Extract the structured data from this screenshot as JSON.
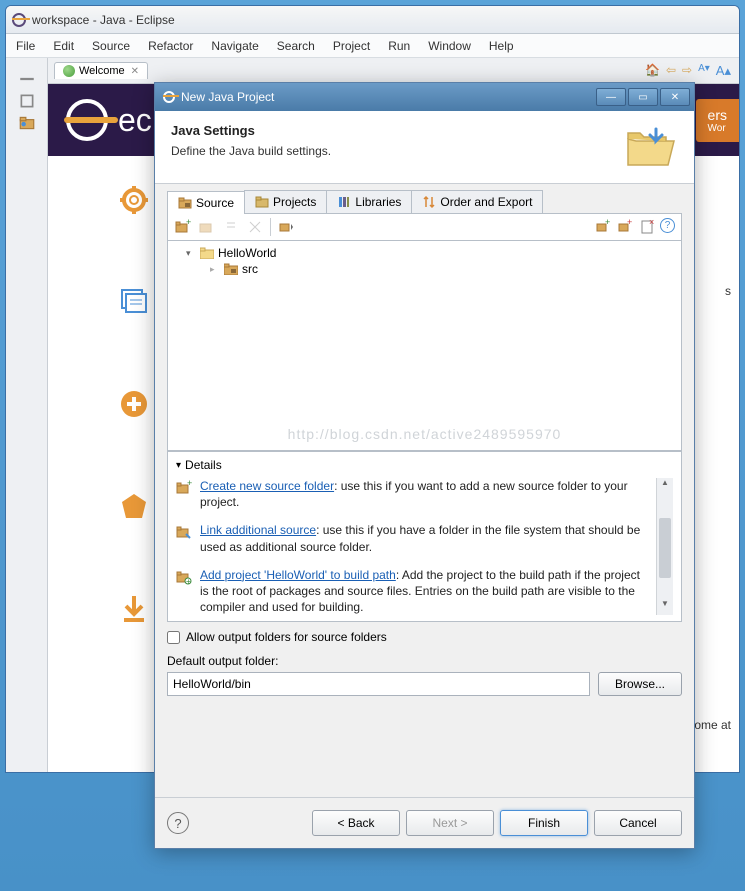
{
  "eclipse": {
    "title": "workspace - Java - Eclipse",
    "menu": [
      "File",
      "Edit",
      "Source",
      "Refactor",
      "Navigate",
      "Search",
      "Project",
      "Run",
      "Window",
      "Help"
    ],
    "welcome_tab": "Welcome",
    "tab_close": "✕",
    "banner_text": "ec",
    "banner_badge_top": "ers",
    "banner_badge_bottom": "Wor",
    "nav_icons": [
      "home-icon",
      "back-icon",
      "forward-icon",
      "text-small-icon",
      "text-large-icon"
    ],
    "side_hint": "s",
    "side_hint2": "ome at"
  },
  "dialog": {
    "title": "New Java Project",
    "controls": {
      "min": "—",
      "max": "▭",
      "close": "✕"
    },
    "header_title": "Java Settings",
    "header_sub": "Define the Java build settings.",
    "tabs": {
      "source": "Source",
      "projects": "Projects",
      "libraries": "Libraries",
      "order": "Order and Export"
    },
    "toolbar": {
      "help_icon": "?"
    },
    "tree": {
      "project": "HelloWorld",
      "src": "src"
    },
    "watermark": "http://blog.csdn.net/active2489595970",
    "details": {
      "heading": "Details",
      "caret": "▾",
      "items": [
        {
          "link": "Create new source folder",
          "text": ": use this if you want to add a new source folder to your project."
        },
        {
          "link": "Link additional source",
          "text": ": use this if you have a folder in the file system that should be used as additional source folder."
        },
        {
          "link": "Add project 'HelloWorld' to build path",
          "text": ": Add the project to the build path if the project is the root of packages and source files. Entries on the build path are visible to the compiler and used for building."
        }
      ]
    },
    "allow_output_label": "Allow output folders for source folders",
    "default_output_label": "Default output folder:",
    "default_output_value": "HelloWorld/bin",
    "browse": "Browse...",
    "footer": {
      "back": "< Back",
      "next": "Next >",
      "finish": "Finish",
      "cancel": "Cancel"
    }
  }
}
